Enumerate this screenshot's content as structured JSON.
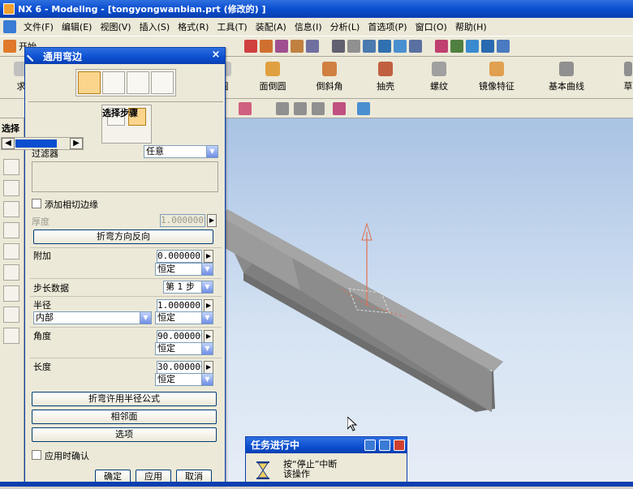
{
  "window": {
    "title": "NX 6 - Modeling - [tongyongwanbian.prt  (修改的) ]"
  },
  "menu": [
    "文件(F)",
    "编辑(E)",
    "视图(V)",
    "插入(S)",
    "格式(R)",
    "工具(T)",
    "装配(A)",
    "信息(I)",
    "分析(L)",
    "首选项(P)",
    "窗口(O)",
    "帮助(H)"
  ],
  "start_label": "开始",
  "ribbon": {
    "items": [
      "求",
      "圆",
      "面倒圆",
      "倒斜角",
      "抽壳",
      "螺纹",
      "镜像特征",
      "基本曲线",
      "草"
    ]
  },
  "select_label": "选择",
  "dialog": {
    "title": "通用弯边",
    "step_label": "选择步骤",
    "filter_label": "过滤器",
    "filter_value": "任意",
    "add_tangent_label": "添加相切边缘",
    "thickness_label": "厚度",
    "thickness_value": "1.000000",
    "reverse_bend_label": "折弯方向反向",
    "additional_label": "附加",
    "additional_value": "0.000000",
    "additional_mode": "恒定",
    "step_data_label": "步长数据",
    "step_value": "第 1 步",
    "radius_label": "半径",
    "radius_value": "1.000000",
    "radius_side": "内部",
    "radius_mode": "恒定",
    "angle_label": "角度",
    "angle_value": "90.000000",
    "angle_mode": "恒定",
    "length_label": "长度",
    "length_value": "30.000000",
    "length_mode": "恒定",
    "formula_button": "折弯许用半径公式",
    "adjacent_button": "相邻面",
    "options_button": "选项",
    "confirm_on_apply_label": "应用时确认",
    "ok_button": "确定",
    "apply_button": "应用",
    "cancel_button": "取消"
  },
  "progress": {
    "title": "任务进行中",
    "message_line1": "按“停止”中断",
    "message_line2": "该操作"
  },
  "colors": {
    "titlebar": "#0b4fd0",
    "viewport_top": "#a9c3e4",
    "selected": "#fbd58c"
  }
}
